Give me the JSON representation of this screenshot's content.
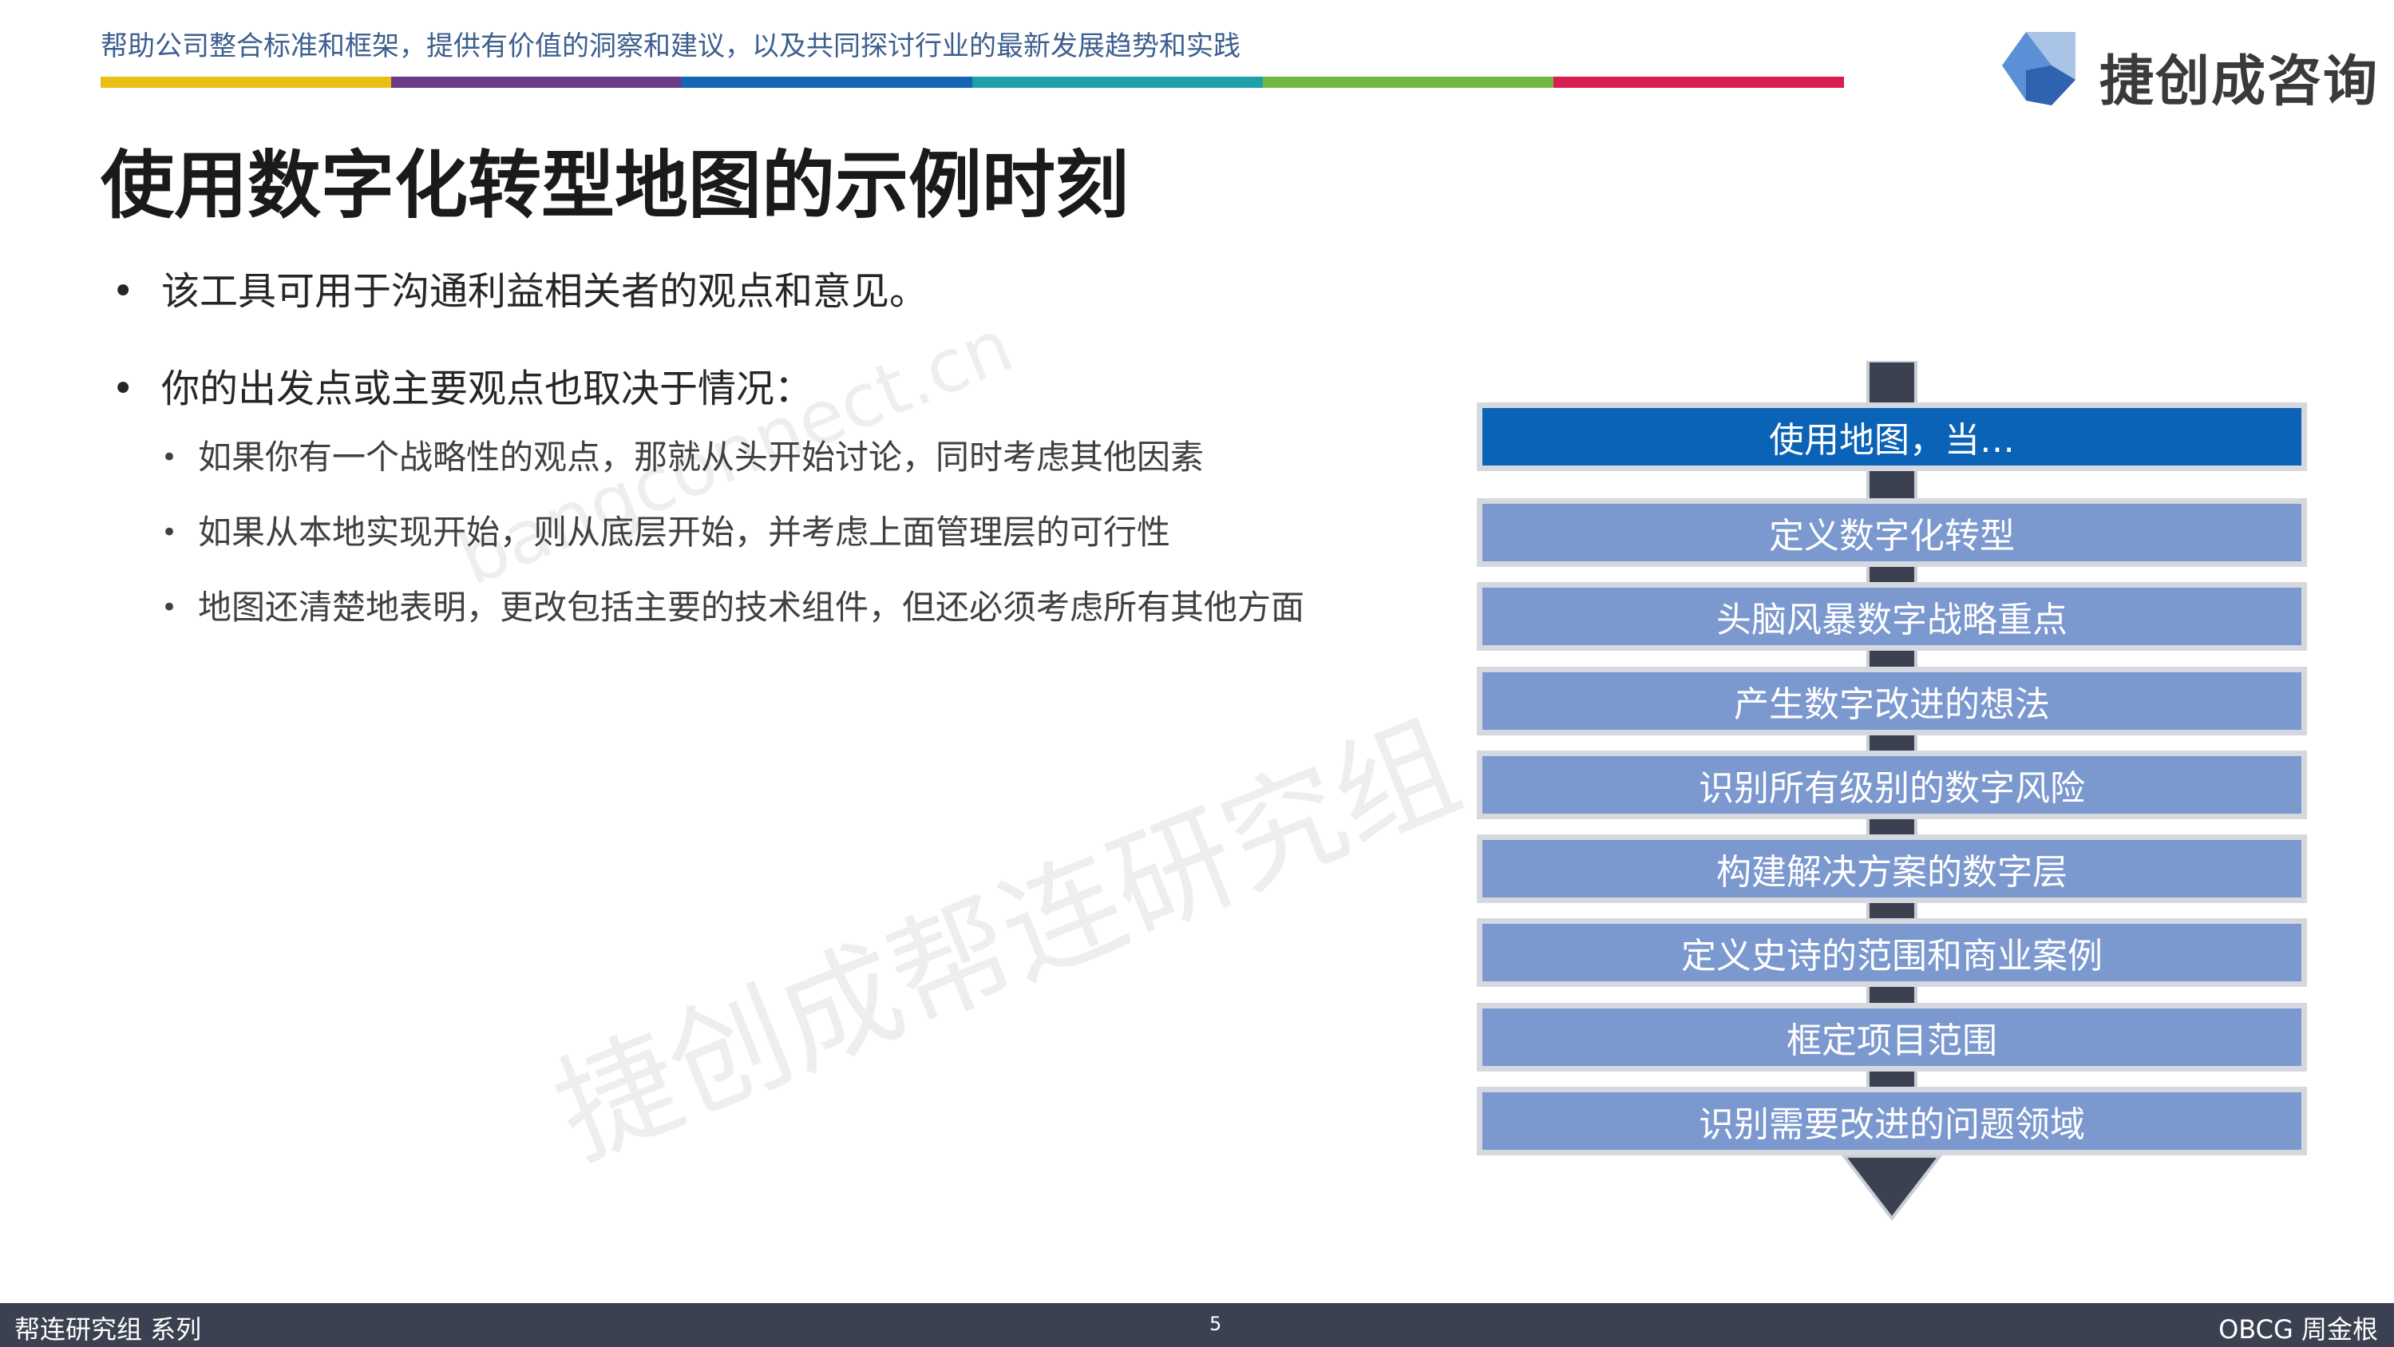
{
  "header": {
    "tagline": "帮助公司整合标准和框架，提供有价值的洞察和建议，以及共同探讨行业的最新发展趋势和实践",
    "color_bar": [
      "#e9bf14",
      "#6b3a8a",
      "#1565b5",
      "#1ea0a8",
      "#72b943",
      "#d61f4e"
    ],
    "logo_text": "捷创成咨询",
    "logo_icon": "cube-icon"
  },
  "title": "使用数字化转型地图的示例时刻",
  "bullets": [
    {
      "text": "该工具可用于沟通利益相关者的观点和意见。",
      "children": []
    },
    {
      "text": "你的出发点或主要观点也取决于情况：",
      "children": [
        "如果你有一个战略性的观点，那就从头开始讨论，同时考虑其他因素",
        "如果从本地实现开始，则从底层开始，并考虑上面管理层的可行性",
        "地图还清楚地表明，更改包括主要的技术组件，但还必须考虑所有其他方面"
      ]
    }
  ],
  "diagram": {
    "header": "使用地图，当…",
    "steps": [
      "定义数字化转型",
      "头脑风暴数字战略重点",
      "产生数字改进的想法",
      "识别所有级别的数字风险",
      "构建解决方案的数字层",
      "定义史诗的范围和商业案例",
      "框定项目范围",
      "识别需要改进的问题领域"
    ],
    "colors": {
      "header": "#0b63b7",
      "step": "#7b98cf",
      "arrow": "#3b4150"
    }
  },
  "watermark": {
    "main": "捷创成帮连研究组",
    "url": "bangconnect.cn"
  },
  "footer": {
    "left": "帮连研究组 系列",
    "page": "5",
    "right": "OBCG 周金根"
  }
}
